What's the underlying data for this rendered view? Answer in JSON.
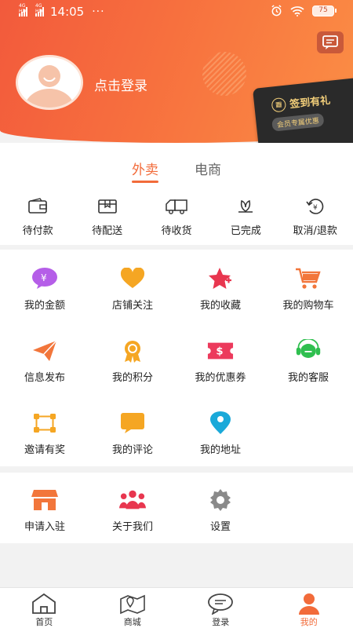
{
  "status_bar": {
    "network1": "4G HD",
    "network2": "4G HD",
    "time": "14:05",
    "dots": "···",
    "battery": "75"
  },
  "profile": {
    "login_text": "点击登录"
  },
  "signin_card": {
    "title": "签到有礼",
    "subtitle": "会员专属优惠"
  },
  "tabs": [
    {
      "label": "外卖",
      "active": true
    },
    {
      "label": "电商",
      "active": false
    }
  ],
  "orders": [
    {
      "label": "待付款",
      "icon": "wallet-icon"
    },
    {
      "label": "待配送",
      "icon": "package-icon"
    },
    {
      "label": "待收货",
      "icon": "truck-icon"
    },
    {
      "label": "已完成",
      "icon": "lotus-icon"
    },
    {
      "label": "取消/退款",
      "icon": "refund-icon"
    }
  ],
  "grid1": [
    {
      "label": "我的金额",
      "icon": "yen-icon",
      "color": "#b55ee8"
    },
    {
      "label": "店铺关注",
      "icon": "heart-icon",
      "color": "#f5a623"
    },
    {
      "label": "我的收藏",
      "icon": "star-icon",
      "color": "#e8364f"
    },
    {
      "label": "我的购物车",
      "icon": "cart-icon",
      "color": "#f2763b"
    },
    {
      "label": "信息发布",
      "icon": "paper-plane-icon",
      "color": "#f2763b"
    },
    {
      "label": "我的积分",
      "icon": "medal-icon",
      "color": "#f5a623"
    },
    {
      "label": "我的优惠券",
      "icon": "coupon-icon",
      "color": "#ec3a5c"
    },
    {
      "label": "我的客服",
      "icon": "headset-icon",
      "color": "#2fbf4f"
    },
    {
      "label": "邀请有奖",
      "icon": "share-icon",
      "color": "#f5a623"
    },
    {
      "label": "我的评论",
      "icon": "comment-icon",
      "color": "#f5a623"
    },
    {
      "label": "我的地址",
      "icon": "location-icon",
      "color": "#1aa9d9"
    }
  ],
  "grid2": [
    {
      "label": "申请入驻",
      "icon": "store-icon",
      "color": "#f2763b"
    },
    {
      "label": "关于我们",
      "icon": "group-icon",
      "color": "#e8364f"
    },
    {
      "label": "设置",
      "icon": "gear-icon",
      "color": "#8a8a8a"
    }
  ],
  "tabbar": [
    {
      "label": "首页",
      "icon": "home-icon",
      "active": false
    },
    {
      "label": "商城",
      "icon": "map-icon",
      "active": false
    },
    {
      "label": "登录",
      "icon": "chat-icon",
      "active": false
    },
    {
      "label": "我的",
      "icon": "user-icon",
      "active": true
    }
  ]
}
